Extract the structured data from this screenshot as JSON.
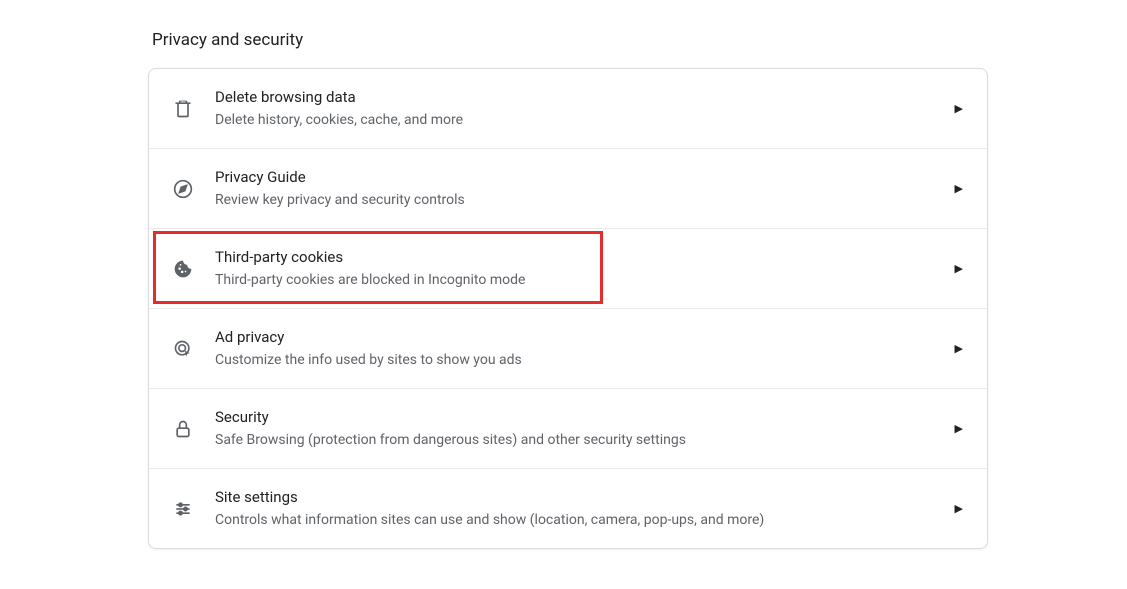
{
  "section_title": "Privacy and security",
  "items": [
    {
      "icon": "trash-icon",
      "title": "Delete browsing data",
      "subtitle": "Delete history, cookies, cache, and more"
    },
    {
      "icon": "compass-icon",
      "title": "Privacy Guide",
      "subtitle": "Review key privacy and security controls"
    },
    {
      "icon": "cookie-icon",
      "title": "Third-party cookies",
      "subtitle": "Third-party cookies are blocked in Incognito mode"
    },
    {
      "icon": "target-cursor-icon",
      "title": "Ad privacy",
      "subtitle": "Customize the info used by sites to show you ads"
    },
    {
      "icon": "lock-icon",
      "title": "Security",
      "subtitle": "Safe Browsing (protection from dangerous sites) and other security settings"
    },
    {
      "icon": "sliders-icon",
      "title": "Site settings",
      "subtitle": "Controls what information sites can use and show (location, camera, pop-ups, and more)"
    }
  ]
}
